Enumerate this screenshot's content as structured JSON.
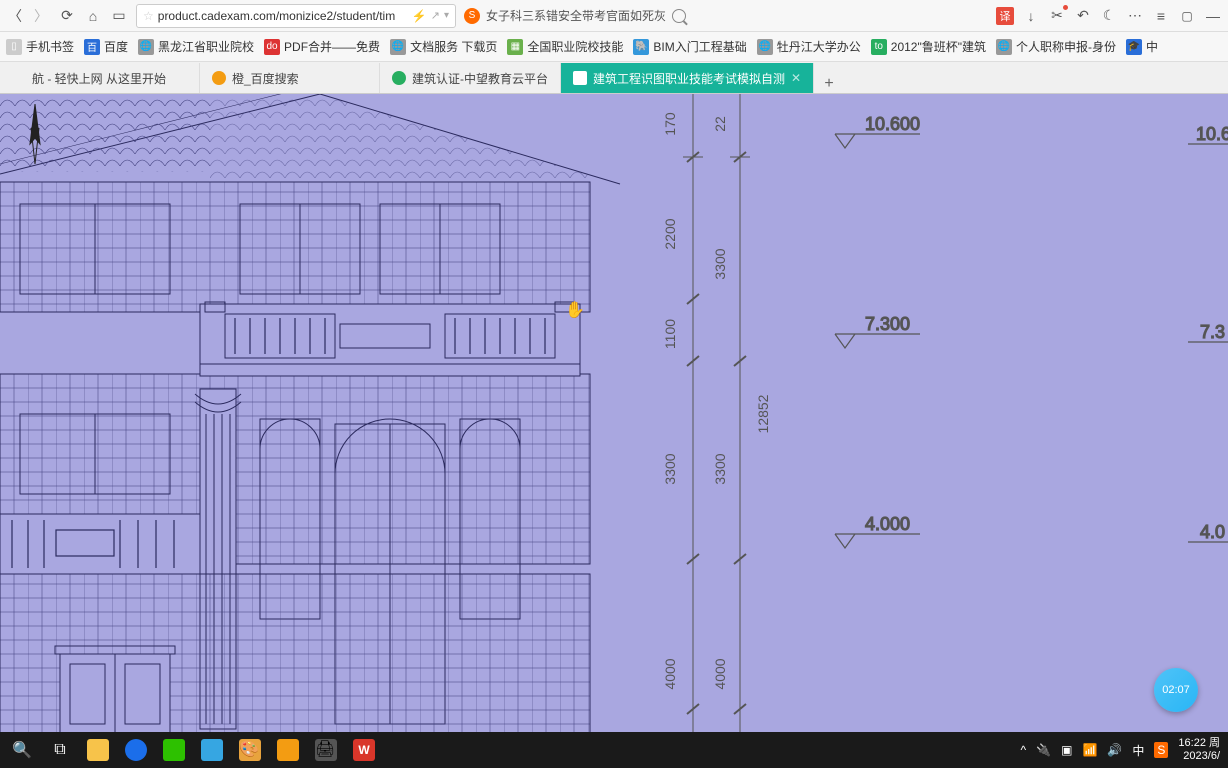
{
  "browser": {
    "url": "product.cadexam.com/monizice2/student/tim",
    "search_text": "女子科三系错安全带考官面如死灰",
    "translate_badge": "译"
  },
  "bookmarks": [
    {
      "label": "手机书签",
      "color": "#888"
    },
    {
      "label": "百度",
      "color": "#2a6ed8"
    },
    {
      "label": "黑龙江省职业院校",
      "color": "#5a8"
    },
    {
      "label": "PDF合并——免费",
      "color": "#d33"
    },
    {
      "label": "文档服务 下载页",
      "color": "#5a8"
    },
    {
      "label": "全国职业院校技能",
      "color": "#6ab04c"
    },
    {
      "label": "BIM入门工程基础",
      "color": "#3498db"
    },
    {
      "label": "牡丹江大学办公",
      "color": "#5a8"
    },
    {
      "label": "2012\"鲁班杯\"建筑",
      "color": "#27ae60"
    },
    {
      "label": "个人职称申报-身份",
      "color": "#5a8"
    },
    {
      "label": "中",
      "color": "#2a6ed8"
    }
  ],
  "tabs": [
    {
      "label": "航 - 轻快上网 从这里开始",
      "icon_color": "#888",
      "active": false
    },
    {
      "label": "橙_百度搜索",
      "icon_color": "#f39c12",
      "active": false
    },
    {
      "label": "建筑认证-中望教育云平台",
      "icon_color": "#27ae60",
      "active": false
    },
    {
      "label": "建筑工程识图职业技能考试模拟自测",
      "icon_color": "#fff",
      "active": true
    }
  ],
  "cad": {
    "dimensions_vertical_left": [
      "170",
      "2200",
      "1100",
      "3300",
      "4000"
    ],
    "dimensions_vertical_mid": [
      "22",
      "3300",
      "3300",
      "4000"
    ],
    "dimensions_vertical_right": [
      "12852"
    ],
    "elevations": [
      "10.600",
      "7.300",
      "4.000"
    ],
    "elevations_right": [
      "10.6",
      "7.3",
      "4.0"
    ]
  },
  "timer": {
    "value": "02:07"
  },
  "taskbar": {
    "time": "16:22 周",
    "date": "2023/6/",
    "ime": "中"
  }
}
